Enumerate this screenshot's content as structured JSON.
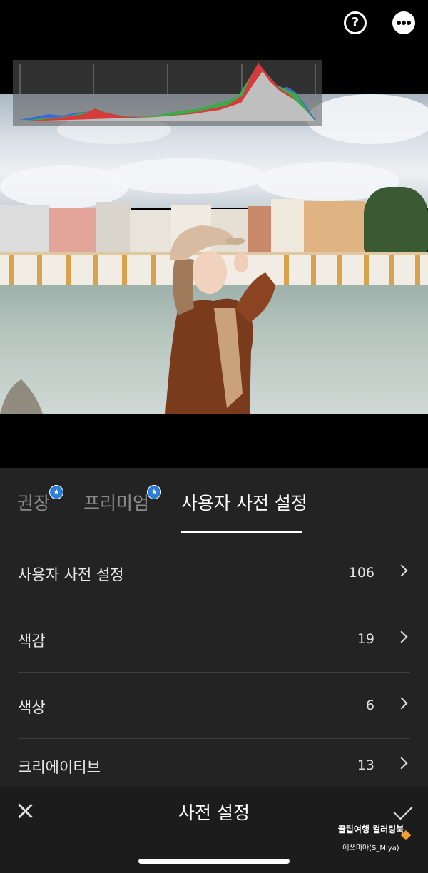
{
  "topbar": {
    "help_label": "?",
    "help_icon": "help-circle-icon",
    "more_icon": "more-dots-icon"
  },
  "tabs": [
    {
      "label": "권장",
      "badge": "★",
      "active": false
    },
    {
      "label": "프리미엄",
      "badge": "★",
      "active": false
    },
    {
      "label": "사용자 사전 설정",
      "active": true
    }
  ],
  "preset_groups": [
    {
      "label": "사용자 사전 설정",
      "count": "106"
    },
    {
      "label": "색감",
      "count": "19"
    },
    {
      "label": "색상",
      "count": "6"
    },
    {
      "label": "크리에이티브",
      "count": "13"
    }
  ],
  "bottombar": {
    "title": "사전 설정",
    "close_icon": "close-icon",
    "confirm_icon": "check-icon"
  },
  "watermark": {
    "line1": "꿀팁여행 컬러링북",
    "line2": "에쓰미야(S_Miya)"
  },
  "colors": {
    "accent": "#2e7ddb",
    "panel_bg": "#232323",
    "bar_bg": "#1c1c1c"
  }
}
